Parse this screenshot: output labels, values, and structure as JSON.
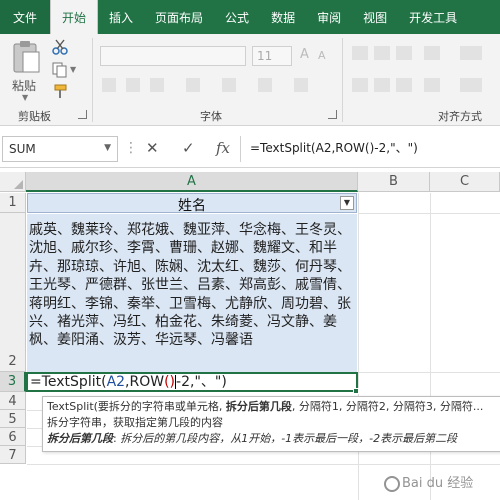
{
  "ribbon": {
    "tabs": [
      "文件",
      "开始",
      "插入",
      "页面布局",
      "公式",
      "数据",
      "审阅",
      "视图",
      "开发工具"
    ],
    "active_tab": "开始",
    "paste_label": "粘贴",
    "groups": [
      "剪贴板",
      "字体",
      "对齐方式"
    ],
    "font_size": "11"
  },
  "formula_bar": {
    "name_box": "SUM",
    "cancel_label": "✕",
    "enter_label": "✓",
    "fx_label": "fx",
    "formula": "=TextSplit(A2,ROW()-2,\"、\")"
  },
  "sheet": {
    "columns": [
      "A",
      "B",
      "C"
    ],
    "rows": [
      "1",
      "2",
      "3",
      "4",
      "5",
      "6",
      "7"
    ],
    "header_cell": "姓名",
    "names_cell": "戚英、魏莱玲、郑花娥、魏亚萍、华念梅、王冬灵、沈旭、戚尔珍、李霄、曹珊、赵娜、魏耀文、和半卉、那琼琼、许旭、陈娴、沈太红、魏莎、何丹琴、王光琴、严德群、张世兰、吕素、郑高彭、戚雪倩、蒋明红、李锦、秦举、卫雪梅、尤静欣、周功碧、张兴、褚光萍、冯红、柏金花、朱绮菱、冯文静、姜枫、姜阳涌、汲芳、华远琴、冯馨语",
    "edit_cell": {
      "prefix": "=TextSplit(",
      "ref": "A2",
      "middle": ",ROW",
      "paren": "()",
      "suffix": "-2,\"、\")"
    }
  },
  "tooltip": {
    "line1_pre": "TextSplit(要拆分的字符串或单元格, ",
    "line1_bold": "拆分后第几段",
    "line1_post": ", 分隔符1, 分隔符2, 分隔符3, 分隔符...",
    "line2": "拆分字符串，获取指定第几段的内容",
    "line3_label": "拆分后第几段",
    "line3_text": "拆分后的第几段内容，从1开始，-1表示最后一段，-2表示最后第二段"
  },
  "watermark": "Bai du 经验",
  "colors": {
    "ribbon_green": "#217346",
    "cell_fill": "#dbe6f4",
    "reference_blue": "#1f4e9c",
    "paren_red": "#c00000"
  },
  "icons": [
    "paste-icon",
    "cut-icon",
    "copy-icon",
    "format-painter-icon",
    "cancel-icon",
    "enter-icon",
    "fx-icon",
    "filter-dropdown-icon"
  ]
}
